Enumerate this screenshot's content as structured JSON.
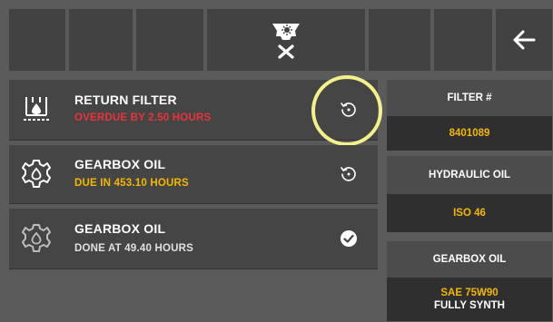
{
  "toolbar": {
    "center_icon": "maintenance-filter-icon",
    "back_icon": "arrow-left-icon"
  },
  "service_items": [
    {
      "title": "RETURN FILTER",
      "status": "OVERDUE BY 2.50 HOURS",
      "status_color": "#e8333a",
      "icon": "filter-icon",
      "action_icon": "reset-icon"
    },
    {
      "title": "GEARBOX OIL",
      "status": "DUE IN 453.10 HOURS",
      "status_color": "#f5b800",
      "icon": "gear-icon",
      "action_icon": "reset-icon"
    },
    {
      "title": "GEARBOX OIL",
      "status": "DONE AT 49.40 HOURS",
      "status_color": "#e0e0e0",
      "icon": "gear-icon",
      "action_icon": "check-icon"
    }
  ],
  "info": {
    "filter": {
      "label": "FILTER #",
      "value": "8401089"
    },
    "hydraulic_oil": {
      "label": "HYDRAULIC OIL",
      "value": "ISO 46"
    },
    "gearbox_oil": {
      "label": "GEARBOX OIL",
      "value_line1": "SAE 75W90",
      "value_line2": "FULLY SYNTH"
    }
  },
  "colors": {
    "overdue": "#e8333a",
    "due": "#f5b800",
    "highlight": "#f4f08a"
  }
}
